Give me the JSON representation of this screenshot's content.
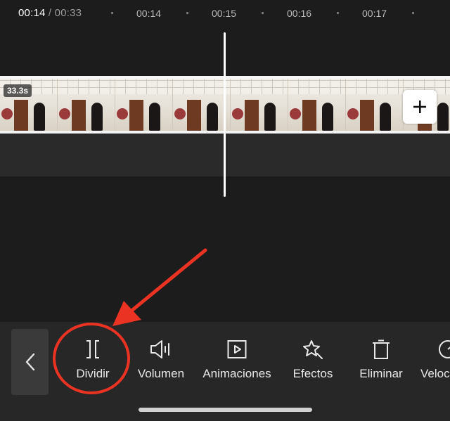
{
  "timeline": {
    "current_time": "00:14",
    "separator": " / ",
    "total_time": "00:33",
    "ticks": [
      "00:14",
      "00:15",
      "00:16",
      "00:17"
    ]
  },
  "clip": {
    "duration_badge": "33.3s",
    "add_button_icon": "plus-icon"
  },
  "toolbar": {
    "back_icon": "chevron-left-icon",
    "tools": [
      {
        "label": "Dividir",
        "icon": "split-icon"
      },
      {
        "label": "Volumen",
        "icon": "speaker-icon"
      },
      {
        "label": "Animaciones",
        "icon": "play-square-icon"
      },
      {
        "label": "Efectos",
        "icon": "sparkle-star-icon"
      },
      {
        "label": "Eliminar",
        "icon": "trash-icon"
      },
      {
        "label": "Veloc",
        "icon": "speed-gauge-icon"
      }
    ]
  },
  "colors": {
    "background": "#1c1c1c",
    "toolbar": "#272727",
    "annotation": "#ea3323",
    "playhead": "#ffffff"
  }
}
